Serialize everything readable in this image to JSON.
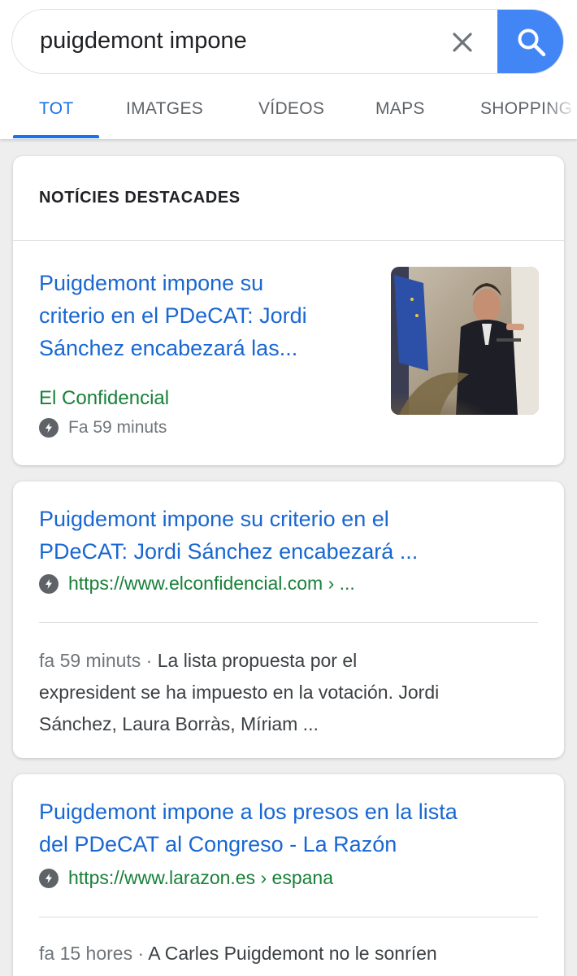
{
  "search": {
    "query": "puigdemont impone"
  },
  "tabs": [
    {
      "label": "TOT",
      "active": true
    },
    {
      "label": "IMATGES"
    },
    {
      "label": "VÍDEOS"
    },
    {
      "label": "MAPS"
    },
    {
      "label": "SHOPPING"
    }
  ],
  "top_stories": {
    "header": "NOTÍCIES DESTACADES",
    "title_lines": [
      "Puigdemont impone su",
      "criterio en el PDeCAT: Jordi",
      "Sánchez encabezará las..."
    ],
    "source": "El Confidencial",
    "time": "Fa 59 minuts"
  },
  "results": [
    {
      "title_lines": [
        "Puigdemont impone su criterio en el",
        "PDeCAT: Jordi Sánchez encabezará ..."
      ],
      "url": "https://www.elconfidencial.com › ...",
      "snippet_time": "fa 59 minuts",
      "snippet_sep": " · ",
      "snippet_lines": [
        "La lista propuesta por el",
        "expresident se ha impuesto en la votación. Jordi",
        "Sánchez, Laura Borràs, Míriam  ..."
      ]
    },
    {
      "title_lines": [
        "Puigdemont impone a los presos en la lista",
        "del PDeCAT al Congreso - La Razón"
      ],
      "url": "https://www.larazon.es › espana",
      "snippet_time": "fa 15 hores",
      "snippet_sep": " · ",
      "snippet_lines": [
        "A Carles Puigdemont no le sonríen"
      ]
    }
  ],
  "colors": {
    "accent": "#1a73e8",
    "search_button": "#4285f4",
    "link": "#1967d2",
    "url_green": "#188038"
  }
}
